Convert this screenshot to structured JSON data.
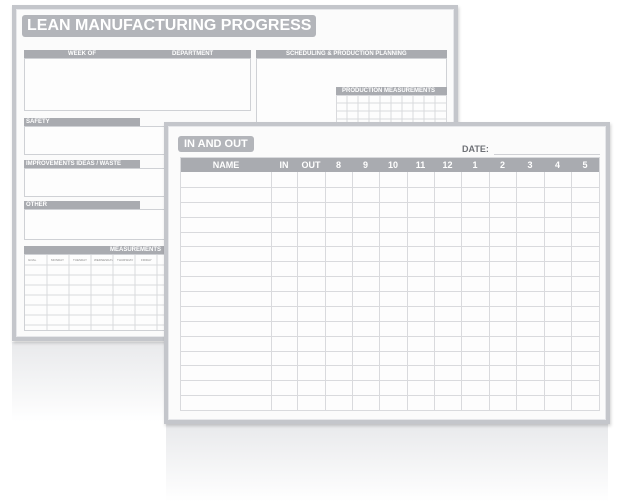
{
  "back_board": {
    "title": "LEAN MANUFACTURING PROGRESS",
    "week_of": "WEEK OF",
    "department": "DEPARTMENT",
    "scheduling": "SCHEDULING & PRODUCTION PLANNING",
    "production_measurements": "PRODUCTION MEASUREMENTS",
    "safety": "SAFETY",
    "improvements": "IMPROVEMENTS IDEAS / WASTE",
    "other": "OTHER",
    "measurements": "MEASUREMENTS",
    "measurement_columns": [
      "GOAL",
      "MONDAY",
      "TUESDAY",
      "WEDNESDAY",
      "THURSDAY",
      "FRIDAY"
    ]
  },
  "front_board": {
    "title": "IN AND OUT",
    "date_label": "DATE:",
    "columns": [
      "NAME",
      "IN",
      "OUT",
      "8",
      "9",
      "10",
      "11",
      "12",
      "1",
      "2",
      "3",
      "4",
      "5"
    ],
    "row_count": 16
  },
  "colors": {
    "frame": "#c4c6cb",
    "header_fill": "#a9abb0",
    "header_text": "#ffffff",
    "board_surface": "#fbfbfb",
    "grid_line": "#d9dadd"
  }
}
